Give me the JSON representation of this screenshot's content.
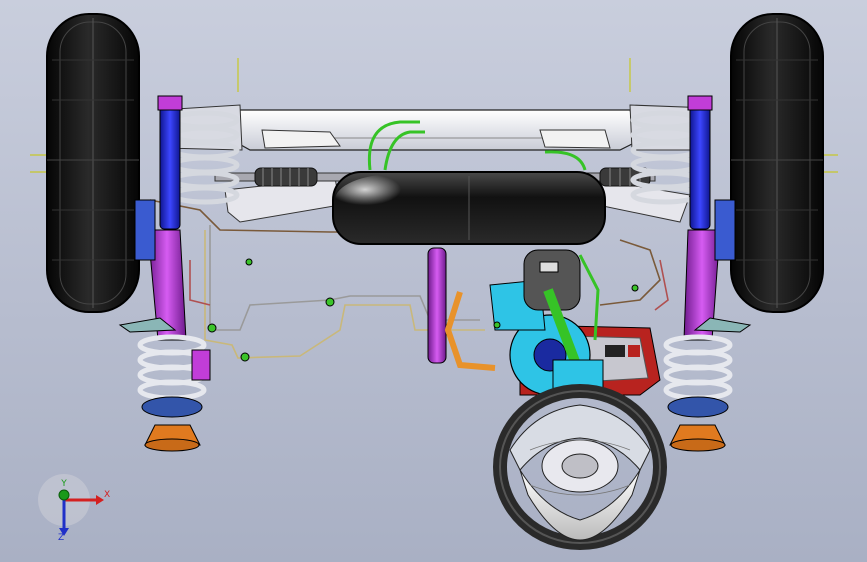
{
  "viewport": {
    "background_top": "#c9cedd",
    "background_bottom": "#a9b0c4"
  },
  "model_colors": {
    "tire": "#111111",
    "frame": "#e8e8ee",
    "shock_blue": "#1f2ad8",
    "arm_purple": "#b43bd6",
    "coil_silver": "#c8ccd6",
    "bump_orange": "#e07a1f",
    "tank_black": "#1a1a1a",
    "green_hose": "#3bc42a",
    "cyan_housing": "#2ec4e6",
    "red_housing": "#b8231f",
    "wheel_white": "#eeeeee"
  },
  "triad": {
    "x_label": "X",
    "y_label": "Y",
    "z_label": "Z",
    "x_color": "#d42020",
    "y_color": "#1a9a1a",
    "z_color": "#2030c8"
  }
}
